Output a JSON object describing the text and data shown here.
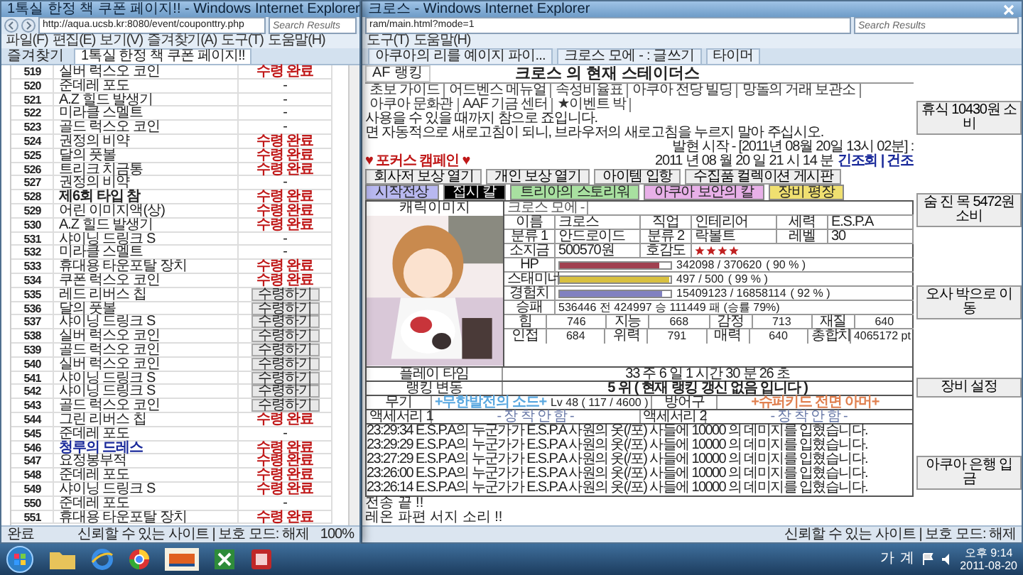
{
  "left_window": {
    "title": "1톡실 한정 책 쿠폰 페이지!! - Windows Internet Explorer",
    "address": "http://aqua.ucsb.kr:8080/event/couponttry.php",
    "search": {
      "placeholder": "Search Results"
    },
    "menu": [
      "파일(F)",
      "편집(E)",
      "보기(V)",
      "즐겨찾기(A)",
      "도구(T)",
      "도움말(H)"
    ],
    "favorites": "즐겨찾기",
    "tab": "1톡실 한정 책 쿠폰 페이지!!",
    "rows": [
      {
        "no": "519",
        "item": "실버 럭스오 코인",
        "kind": "done",
        "status": "수령 완료"
      },
      {
        "no": "520",
        "item": "준데레 포도",
        "kind": "none",
        "status": "-"
      },
      {
        "no": "521",
        "item": "A.Z 힐드 발생기",
        "kind": "none",
        "status": "-"
      },
      {
        "no": "522",
        "item": "미라클 스멜트",
        "kind": "none",
        "status": "-"
      },
      {
        "no": "523",
        "item": "골드 럭스오 코인",
        "kind": "none",
        "status": "-"
      },
      {
        "no": "524",
        "item": "권정의 비약",
        "kind": "done",
        "status": "수령 완료"
      },
      {
        "no": "525",
        "item": "달의 풋볼",
        "kind": "done",
        "status": "수령 완료"
      },
      {
        "no": "526",
        "item": "트리크 치금통",
        "kind": "done",
        "status": "수령 완료"
      },
      {
        "no": "527",
        "item": "권정의 비약",
        "kind": "none",
        "status": "-"
      },
      {
        "no": "528",
        "item": "제6회 타입 참",
        "bold": true,
        "kind": "done",
        "status": "수령 완료"
      },
      {
        "no": "529",
        "item": "어린 이미지액(상)",
        "kind": "done",
        "status": "수령 완료"
      },
      {
        "no": "530",
        "item": "A.Z 힐드 발생기",
        "kind": "done",
        "status": "수령 완료"
      },
      {
        "no": "531",
        "item": "샤이닝 드링크 S",
        "kind": "none",
        "status": "-"
      },
      {
        "no": "532",
        "item": "미라클 스멜트",
        "kind": "none",
        "status": "-"
      },
      {
        "no": "533",
        "item": "휴대용 타운포탈 장치",
        "kind": "done",
        "status": "수령 완료"
      },
      {
        "no": "534",
        "item": "쿠폰 럭스오 코인",
        "kind": "done",
        "status": "수령 완료"
      },
      {
        "no": "535",
        "item": "레드 리버스 칩",
        "kind": "button",
        "status": "수령하기"
      },
      {
        "no": "536",
        "item": "달의 풋볼",
        "kind": "button",
        "status": "수령하기"
      },
      {
        "no": "537",
        "item": "샤이닝 드링크 S",
        "kind": "button",
        "status": "수령하기"
      },
      {
        "no": "538",
        "item": "실버 럭스오 코인",
        "kind": "button",
        "status": "수령하기"
      },
      {
        "no": "539",
        "item": "골드 럭스오 코인",
        "kind": "button",
        "status": "수령하기"
      },
      {
        "no": "540",
        "item": "실버 럭스오 코인",
        "kind": "button",
        "status": "수령하기"
      },
      {
        "no": "541",
        "item": "샤이닝 드링크 S",
        "kind": "button",
        "status": "수령하기"
      },
      {
        "no": "542",
        "item": "샤이닝 드링크 S",
        "kind": "button",
        "status": "수령하기"
      },
      {
        "no": "543",
        "item": "골드 럭스오 코인",
        "kind": "button",
        "status": "수령하기"
      },
      {
        "no": "544",
        "item": "그린 리버스 칩",
        "kind": "done",
        "status": "수령 완료"
      },
      {
        "no": "545",
        "item": "준데레 포도",
        "kind": "none",
        "status": "-"
      },
      {
        "no": "546",
        "item": "청루의 드레스",
        "bold": true,
        "color": "#1a2a9a",
        "kind": "done",
        "status": "수령 완료"
      },
      {
        "no": "547",
        "item": "요정봉부적",
        "kind": "done",
        "status": "수령 완료"
      },
      {
        "no": "548",
        "item": "준데레 포도",
        "kind": "done",
        "status": "수령 완료"
      },
      {
        "no": "549",
        "item": "샤이닝 드링크 S",
        "kind": "done",
        "status": "수령 완료"
      },
      {
        "no": "550",
        "item": "준데레 포도",
        "kind": "none",
        "status": "-"
      },
      {
        "no": "551",
        "item": "휴대용 타운포탈 장치",
        "kind": "done",
        "status": "수령 완료"
      }
    ],
    "status": "완료",
    "zone": "신뢰할 수 있는 사이트 | 보호 모드: 해제",
    "zoom": "100%"
  },
  "right_window": {
    "title": "크로스 - Windows Internet Explorer",
    "address": "ram/main.html?mode=1",
    "search": {
      "placeholder": "Search Results"
    },
    "menu": [
      "도구(T)",
      "도움말(H)"
    ],
    "tabs": [
      {
        "label": "아쿠아의 리를 예이지 파이...",
        "selected": false
      },
      {
        "label": "크로스 모에 - : 글쓰기",
        "selected": false
      },
      {
        "label": "타이머",
        "selected": false
      }
    ],
    "page": {
      "ranking_tab": "AF 랭킹",
      "heading": "크로스 의 현재 스테이더스",
      "nav": [
        "초보 가이드",
        "어드벤스 메뉴얼",
        "속성비율표",
        "아쿠아 전당 빌딩",
        "망돌의 거래 보관소",
        "아쿠아 문화관",
        "AAF 기금 센터",
        "★이벤트 박"
      ],
      "notice": [
        "사용을 수 있을 때까지 참으로 죠입니다.",
        "면 자동적으로 새로고침이 되니, 브라우저의 새로고침을 누르지 말아 주십시오."
      ],
      "start_line": "발현 시작 - [2011년 08월 20일 13시 02분] : ",
      "date_line": "2011 년 08 월 20 일 21 시 14 분",
      "date_link": "긴조회 | 건조",
      "focus": "♥ 포커스 캠페인 ♥",
      "actions": [
        "회사저 보상 열기",
        "개인 보상 열기",
        "아이템 입항",
        "수집품 컬렉이션 게시판"
      ],
      "tags": [
        {
          "label": "시작전상",
          "color": "#b8b8f0"
        },
        {
          "label": "접시 칼",
          "color": "#000000"
        },
        {
          "label": "트리아의 스토리워",
          "color": "#a8e0a0"
        },
        {
          "label": "아쿠아 보안의 칼",
          "color": "#e8b0e8"
        },
        {
          "label": "장비 평장",
          "color": "#f0e070"
        }
      ],
      "picture_caption": "캐릭이미지",
      "profile_title": "크로스 모에 -",
      "pairs": [
        [
          {
            "label": "이름",
            "value": "크로스"
          },
          {
            "label": "직업",
            "value": "인테리어"
          },
          {
            "label": "세력",
            "value": "E.S.P.A"
          }
        ],
        [
          {
            "label": "분류 1",
            "value": "안드로이드"
          },
          {
            "label": "분류 2",
            "value": "락볼트"
          },
          {
            "label": "레벨",
            "value": "30"
          }
        ],
        [
          {
            "label": "소지금",
            "value": "500570원"
          }
        ]
      ],
      "affection": {
        "label": "호감도",
        "stars": 4
      },
      "meters": [
        {
          "label": "HP",
          "reading": "342098 / 370620",
          "percent": "( 90 % )",
          "level": 0.9,
          "color": "#a04050"
        },
        {
          "label": "스태미너",
          "reading": "497 / 500",
          "percent": "( 99 % )",
          "level": 0.99,
          "color": "#d8c040"
        },
        {
          "label": "경험치",
          "reading": "15409123 / 16858114",
          "percent": "( 92 % )",
          "level": 0.92,
          "color": "#8080c0"
        }
      ],
      "record": {
        "label": "승패",
        "value": "536446 전 424997 승 111449 패 (승률 79%)"
      },
      "stats": [
        [
          {
            "label": "힘",
            "value": "746"
          },
          {
            "label": "지능",
            "value": "668"
          },
          {
            "label": "감정",
            "value": "713"
          },
          {
            "label": "재질",
            "value": "640"
          }
        ],
        [
          {
            "label": "인접",
            "value": "684"
          },
          {
            "label": "위력",
            "value": "791"
          },
          {
            "label": "매력",
            "value": "640"
          },
          {
            "label": "총합치",
            "value": "4065172 pt"
          }
        ]
      ],
      "playtime": {
        "label": "플레이 타임",
        "value": "33 주 6 일 1 시간 30 분 26 초"
      },
      "rank": {
        "label": "랭킹 변동",
        "value": "5 위 ( 현재 랭킹 갱신 없음 입니다 )"
      },
      "gear": [
        {
          "label": "무기",
          "name": "+무한발전의 소드+",
          "detail": "Lv 48 ( 117 / 4600 )",
          "color": "#5aa8e0"
        },
        {
          "label": "방어구",
          "name": "+슈퍼키드 전면 아머+",
          "color": "#e08050"
        }
      ],
      "accessories": [
        {
          "label": "액세서리 1",
          "value": "- 장 착 안 함 -"
        },
        {
          "label": "액세서리 2",
          "value": "- 장 착 안 함 -"
        }
      ],
      "log": [
        "23:29:34 E.S.P.A의 누군가가 E.S.P.A 사원의 옷(/포) 사들에 10000 의 데미지를 입혔습니다.",
        "23:29:29 E.S.P.A의 누군가가 E.S.P.A 사원의 옷(/포) 사들에 10000 의 데미지를 입혔습니다.",
        "23:27:29 E.S.P.A의 누군가가 E.S.P.A 사원의 옷(/포) 사들에 10000 의 데미지를 입혔습니다.",
        "23:26:00 E.S.P.A의 누군가가 E.S.P.A 사원의 옷(/포) 사들에 10000 의 데미지를 입혔습니다.",
        "23:26:14 E.S.P.A의 누군가가 E.S.P.A 사원의 옷(/포) 사들에 10000 의 데미지를 입혔습니다."
      ],
      "log_end": [
        "전송 끝 !!",
        "레온 파편 서지 소리 !!"
      ],
      "side_buttons": [
        "휴식 10430원 소비",
        "숨 진 목 5472원 소비",
        "오사 박으로 이동",
        "장비 설정",
        "아쿠아 은행 입금"
      ]
    },
    "zone": "신뢰할 수 있는 사이트 | 보호 모드: 해제"
  },
  "taskbar": {
    "ime": "가",
    "layout": "계",
    "time": "오후 9:14",
    "date": "2011-08-20"
  }
}
